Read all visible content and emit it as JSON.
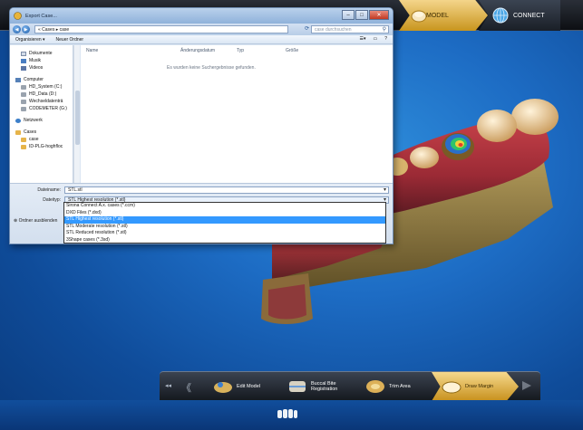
{
  "app": {
    "tabs": [
      {
        "label": "MODEL",
        "icon": "crown-icon"
      },
      {
        "label": "CONNECT",
        "icon": "globe-icon"
      }
    ]
  },
  "dialog": {
    "title": "Export Case...",
    "path": "« Cases ▸ case",
    "search_placeholder": "case durchsuchen",
    "toolbar": {
      "organize": "Organisieren ▾",
      "new_folder": "Neuer Ordner"
    },
    "nav_items": [
      {
        "label": "Dokumente",
        "icon": "folder-icon"
      },
      {
        "label": "Musik",
        "icon": "music-icon"
      },
      {
        "label": "Videos",
        "icon": "video-icon"
      },
      {
        "label": "Computer",
        "icon": "computer-icon"
      },
      {
        "label": "HD_System (C:)",
        "icon": "drive-icon"
      },
      {
        "label": "HD_Data (D:)",
        "icon": "drive-icon"
      },
      {
        "label": "Wechseldatenträ",
        "icon": "drive-icon"
      },
      {
        "label": "CODEMETER (G:)",
        "icon": "drive-icon"
      },
      {
        "label": "Netzwerk",
        "icon": "network-icon"
      },
      {
        "label": "Cases",
        "icon": "folder-icon"
      },
      {
        "label": "case",
        "icon": "folder-icon"
      },
      {
        "label": "ID-PLG-hoghfloc",
        "icon": "folder-icon"
      }
    ],
    "columns": [
      "Name",
      "Änderungsdatum",
      "Typ",
      "Größe"
    ],
    "empty_message": "Es wurden keine Suchergebnisse gefunden.",
    "filename_label": "Dateiname:",
    "filename_value": "STL.stl",
    "filetype_label": "Dateityp:",
    "filetype_value": "STL Highest resolution (*.stl)",
    "hide_folders": "Ordner ausblenden",
    "filetype_options": [
      "Sirona Connect A.x. cases (*.ccm)",
      "DXD Files (*.dxd)",
      "STL Highest resolution (*.stl)",
      "STL Moderate resolution (*.stl)",
      "STL Reduced resolution (*.stl)",
      "3Shape cases (*.3sd)"
    ],
    "selected_option": 2
  },
  "workflow": {
    "steps": [
      {
        "label": "Edit Model"
      },
      {
        "label": "Buccal Bite Registration"
      },
      {
        "label": "Trim Area"
      },
      {
        "label": "Draw Margin"
      }
    ],
    "active_step": 3
  },
  "colors": {
    "accent_gold": "#d9a63a",
    "background_blue": "#1d6cc4",
    "selection_blue": "#3399ff"
  }
}
